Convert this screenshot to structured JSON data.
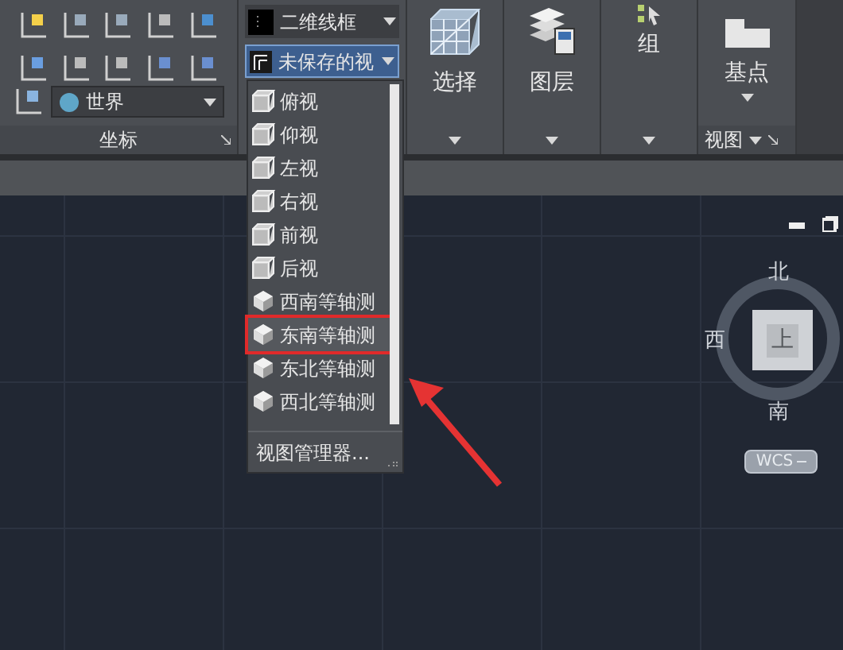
{
  "ribbon": {
    "coordinate_panel": {
      "ucs_combo": "世界",
      "label": "坐标"
    },
    "visual_style_combo": "二维线框",
    "view_combo": {
      "value": "未保存的视",
      "open": true
    },
    "big_buttons": [
      {
        "label": "选择",
        "kind": "cube"
      },
      {
        "label": "图层",
        "kind": "layers"
      },
      {
        "label": "组",
        "kind": "group"
      }
    ],
    "view_panel": {
      "button": "基点",
      "label": "视图"
    }
  },
  "view_menu": {
    "items": [
      {
        "label": "俯视",
        "kind": "ortho",
        "selected": false
      },
      {
        "label": "仰视",
        "kind": "ortho",
        "selected": false
      },
      {
        "label": "左视",
        "kind": "ortho",
        "selected": false
      },
      {
        "label": "右视",
        "kind": "ortho",
        "selected": false
      },
      {
        "label": "前视",
        "kind": "ortho",
        "selected": false
      },
      {
        "label": "后视",
        "kind": "ortho",
        "selected": false
      },
      {
        "label": "西南等轴测",
        "kind": "iso",
        "selected": false
      },
      {
        "label": "东南等轴测",
        "kind": "iso",
        "selected": true
      },
      {
        "label": "东北等轴测",
        "kind": "iso",
        "selected": false
      },
      {
        "label": "西北等轴测",
        "kind": "iso",
        "selected": false
      }
    ],
    "footer": "视图管理器..."
  },
  "viewcube": {
    "north": "北",
    "west": "西",
    "south": "南",
    "face": "上",
    "coordinate_system": "WCS"
  }
}
